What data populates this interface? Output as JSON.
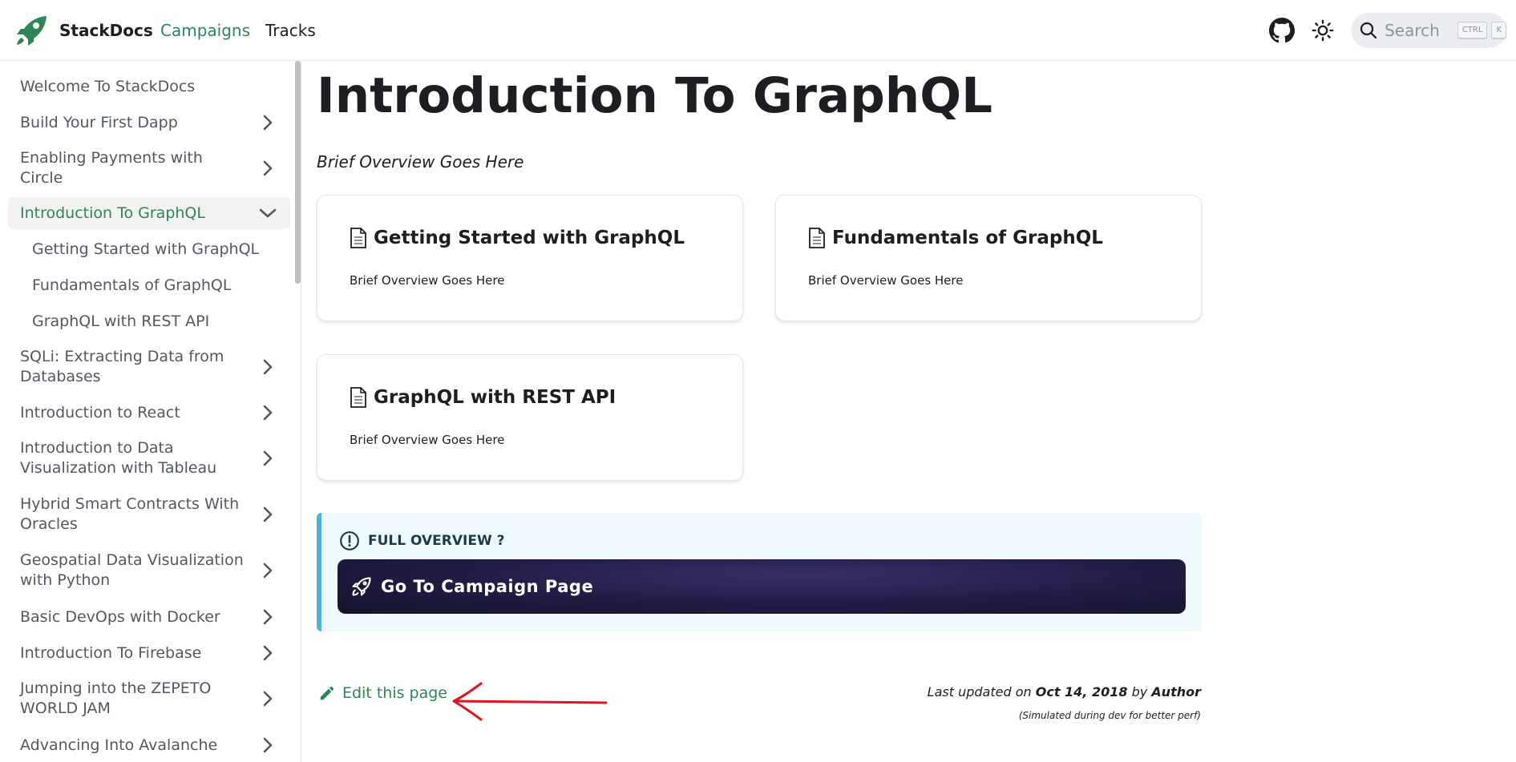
{
  "navbar": {
    "brand": "StackDocs",
    "links": [
      "Campaigns",
      "Tracks"
    ],
    "search_placeholder": "Search",
    "search_keys": [
      "CTRL",
      "K"
    ],
    "icons": [
      "github-icon",
      "sun-icon",
      "search-icon"
    ]
  },
  "sidebar": {
    "items": [
      {
        "label": "Welcome To StackDocs",
        "chevron": "none"
      },
      {
        "label": "Build Your First Dapp",
        "chevron": "right"
      },
      {
        "label": "Enabling Payments with Circle",
        "chevron": "right"
      },
      {
        "label": "Introduction To GraphQL",
        "chevron": "down",
        "active": true
      },
      {
        "label": "Getting Started with GraphQL",
        "chevron": "none",
        "sub": true
      },
      {
        "label": "Fundamentals of GraphQL",
        "chevron": "none",
        "sub": true
      },
      {
        "label": "GraphQL with REST API",
        "chevron": "none",
        "sub": true
      },
      {
        "label": "SQLi: Extracting Data from Databases",
        "chevron": "right"
      },
      {
        "label": "Introduction to React",
        "chevron": "right"
      },
      {
        "label": "Introduction to Data Visualization with Tableau",
        "chevron": "right"
      },
      {
        "label": "Hybrid Smart Contracts With Oracles",
        "chevron": "right"
      },
      {
        "label": "Geospatial Data Visualization with Python",
        "chevron": "right"
      },
      {
        "label": "Basic DevOps with Docker",
        "chevron": "right"
      },
      {
        "label": "Introduction To Firebase",
        "chevron": "right"
      },
      {
        "label": "Jumping into the ZEPETO WORLD JAM",
        "chevron": "right"
      },
      {
        "label": "Advancing Into Avalanche",
        "chevron": "right"
      }
    ]
  },
  "main": {
    "title": "Introduction To GraphQL",
    "description": "Brief Overview Goes Here",
    "cards": [
      {
        "title": "Getting Started with GraphQL",
        "description": "Brief Overview Goes Here"
      },
      {
        "title": "Fundamentals of GraphQL",
        "description": "Brief Overview Goes Here"
      },
      {
        "title": "GraphQL with REST API",
        "description": "Brief Overview Goes Here"
      }
    ],
    "admonition": {
      "heading": "FULL OVERVIEW ?",
      "button_label": "Go To Campaign Page"
    },
    "edit_label": "Edit this page",
    "last_updated": {
      "prefix": "Last updated on",
      "date": "Oct 14, 2018",
      "by": "by",
      "author": "Author",
      "note": "(Simulated during dev for better perf)"
    }
  },
  "colors": {
    "primary": "#2e8555",
    "admonition_bg": "#eef9fd",
    "admonition_border": "#4cb3d4",
    "cta_bg": "#231c46",
    "annotation_arrow": "#e0141e"
  }
}
